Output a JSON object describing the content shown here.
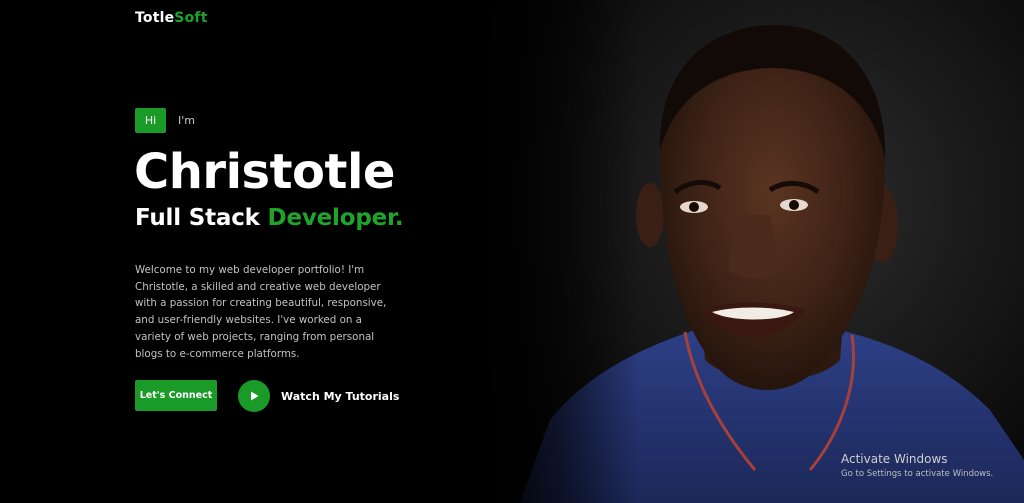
{
  "logo": {
    "part1": "Totle",
    "part2": "Soft"
  },
  "hero": {
    "greeting_badge": "Hi",
    "greeting_text": "I'm",
    "name": "Christotle",
    "role_part1": "Full Stack",
    "role_part2": "Developer.",
    "intro": "Welcome to my web developer portfolio! I'm Christotle, a skilled and creative web developer with a passion for creating beautiful, responsive, and user-friendly websites. I've worked on a variety of web projects, ranging from personal blogs to e-commerce platforms.",
    "connect_label": "Let's Connect",
    "tutorial_label": "Watch My Tutorials"
  },
  "watermark": {
    "title": "Activate Windows",
    "subtitle": "Go to Settings to activate Windows."
  },
  "colors": {
    "accent": "#1a9b28",
    "accent_text": "#1fa32a",
    "background": "#000000",
    "body_text": "#c2c2c2"
  },
  "icons": {
    "play": "play-icon"
  },
  "media": {
    "portrait": "portrait-photo"
  }
}
